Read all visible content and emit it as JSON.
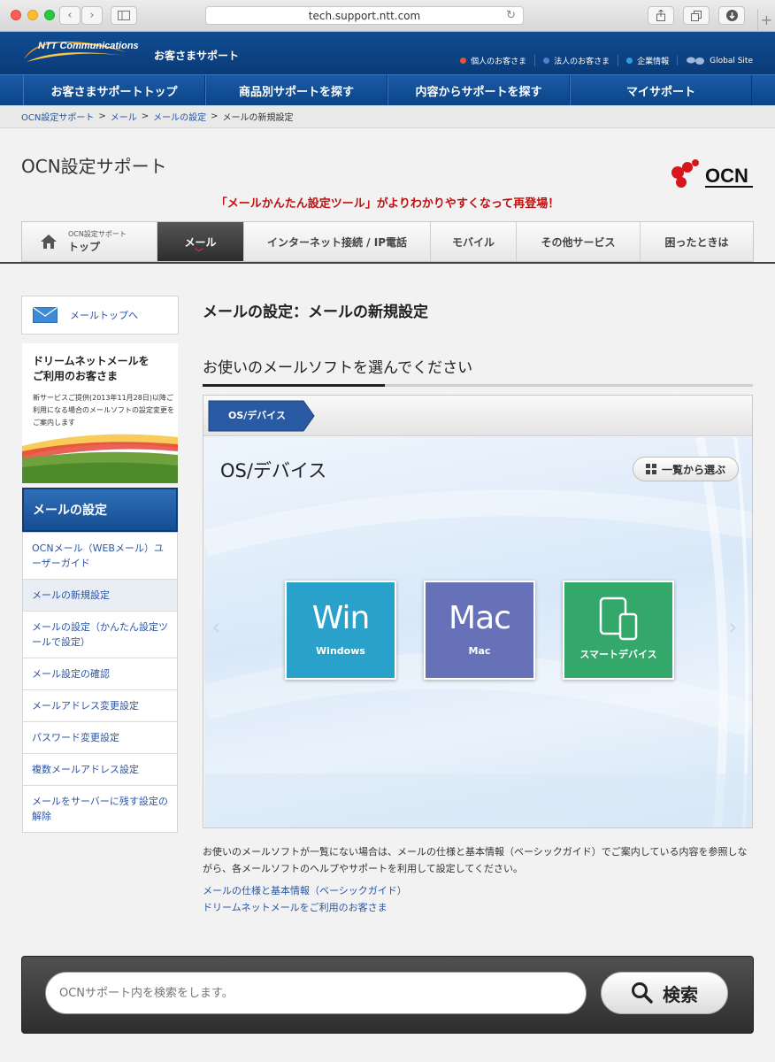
{
  "browser": {
    "url": "tech.support.ntt.com"
  },
  "header": {
    "logo_text": "NTT Communications",
    "title": "お客さまサポート",
    "links": [
      {
        "label": "個人のお客さま",
        "color": "#e8542e"
      },
      {
        "label": "法人のお客さま",
        "color": "#4a7fd4"
      },
      {
        "label": "企業情報",
        "color": "#2f9ee0"
      },
      {
        "label": "Global Site"
      }
    ]
  },
  "mainnav": {
    "items": [
      "お客さまサポートトップ",
      "商品別サポートを探す",
      "内容からサポートを探す",
      "マイサポート"
    ]
  },
  "breadcrumb": {
    "items": [
      "OCN設定サポート",
      "メール",
      "メールの設定"
    ],
    "current": "メールの新規設定"
  },
  "page": {
    "title": "OCN設定サポート",
    "promo": "「メールかんたん設定ツール」がよりわかりやすくなって再登場！",
    "ocn_logo_text": "OCN"
  },
  "subnav": {
    "home_small": "OCN設定サポート",
    "home_big": "トップ",
    "items": [
      "メール",
      "インターネット接続 / IP電話",
      "モバイル",
      "その他サービス",
      "困ったときは"
    ],
    "active_index": 0
  },
  "sidebar": {
    "mail_top": "メールトップへ",
    "banner_title_1": "ドリームネットメールを",
    "banner_title_2": "ご利用のお客さま",
    "banner_sub": "新サービスご提供(2013年11月28日)以降ご利用になる場合のメールソフトの設定変更をご案内します",
    "heading": "メールの設定",
    "items": [
      "OCNメール（WEBメール）ユーザーガイド",
      "メールの新規設定",
      "メールの設定（かんたん設定ツールで設定）",
      "メール設定の確認",
      "メールアドレス変更設定",
      "パスワード変更設定",
      "複数メールアドレス設定",
      "メールをサーバーに残す設定の解除"
    ],
    "current_index": 1
  },
  "main": {
    "heading": "メールの設定：メールの新規設定",
    "subheading": "お使いのメールソフトを選んでください",
    "tab_label": "OS/デバイス",
    "stage_title": "OS/デバイス",
    "list_button": "一覧から選ぶ",
    "tiles": [
      {
        "big": "Win",
        "small": "Windows"
      },
      {
        "big": "Mac",
        "small": "Mac"
      },
      {
        "small": "スマートデバイス"
      }
    ],
    "note": "お使いのメールソフトが一覧にない場合は、メールの仕様と基本情報（ベーシックガイド）でご案内している内容を参照しながら、各メールソフトのヘルプやサポートを利用して設定してください。",
    "links": [
      "メールの仕様と基本情報（ベーシックガイド）",
      "ドリームネットメールをご利用のお客さま"
    ]
  },
  "search": {
    "placeholder": "OCNサポート内を検索をします。",
    "button": "検索"
  },
  "colors": {
    "ntt_blue": "#0f4c92",
    "promo_red": "#c0100f",
    "win_tile": "#2aa1cb",
    "mac_tile": "#6671b7",
    "smart_tile": "#33a86a"
  }
}
